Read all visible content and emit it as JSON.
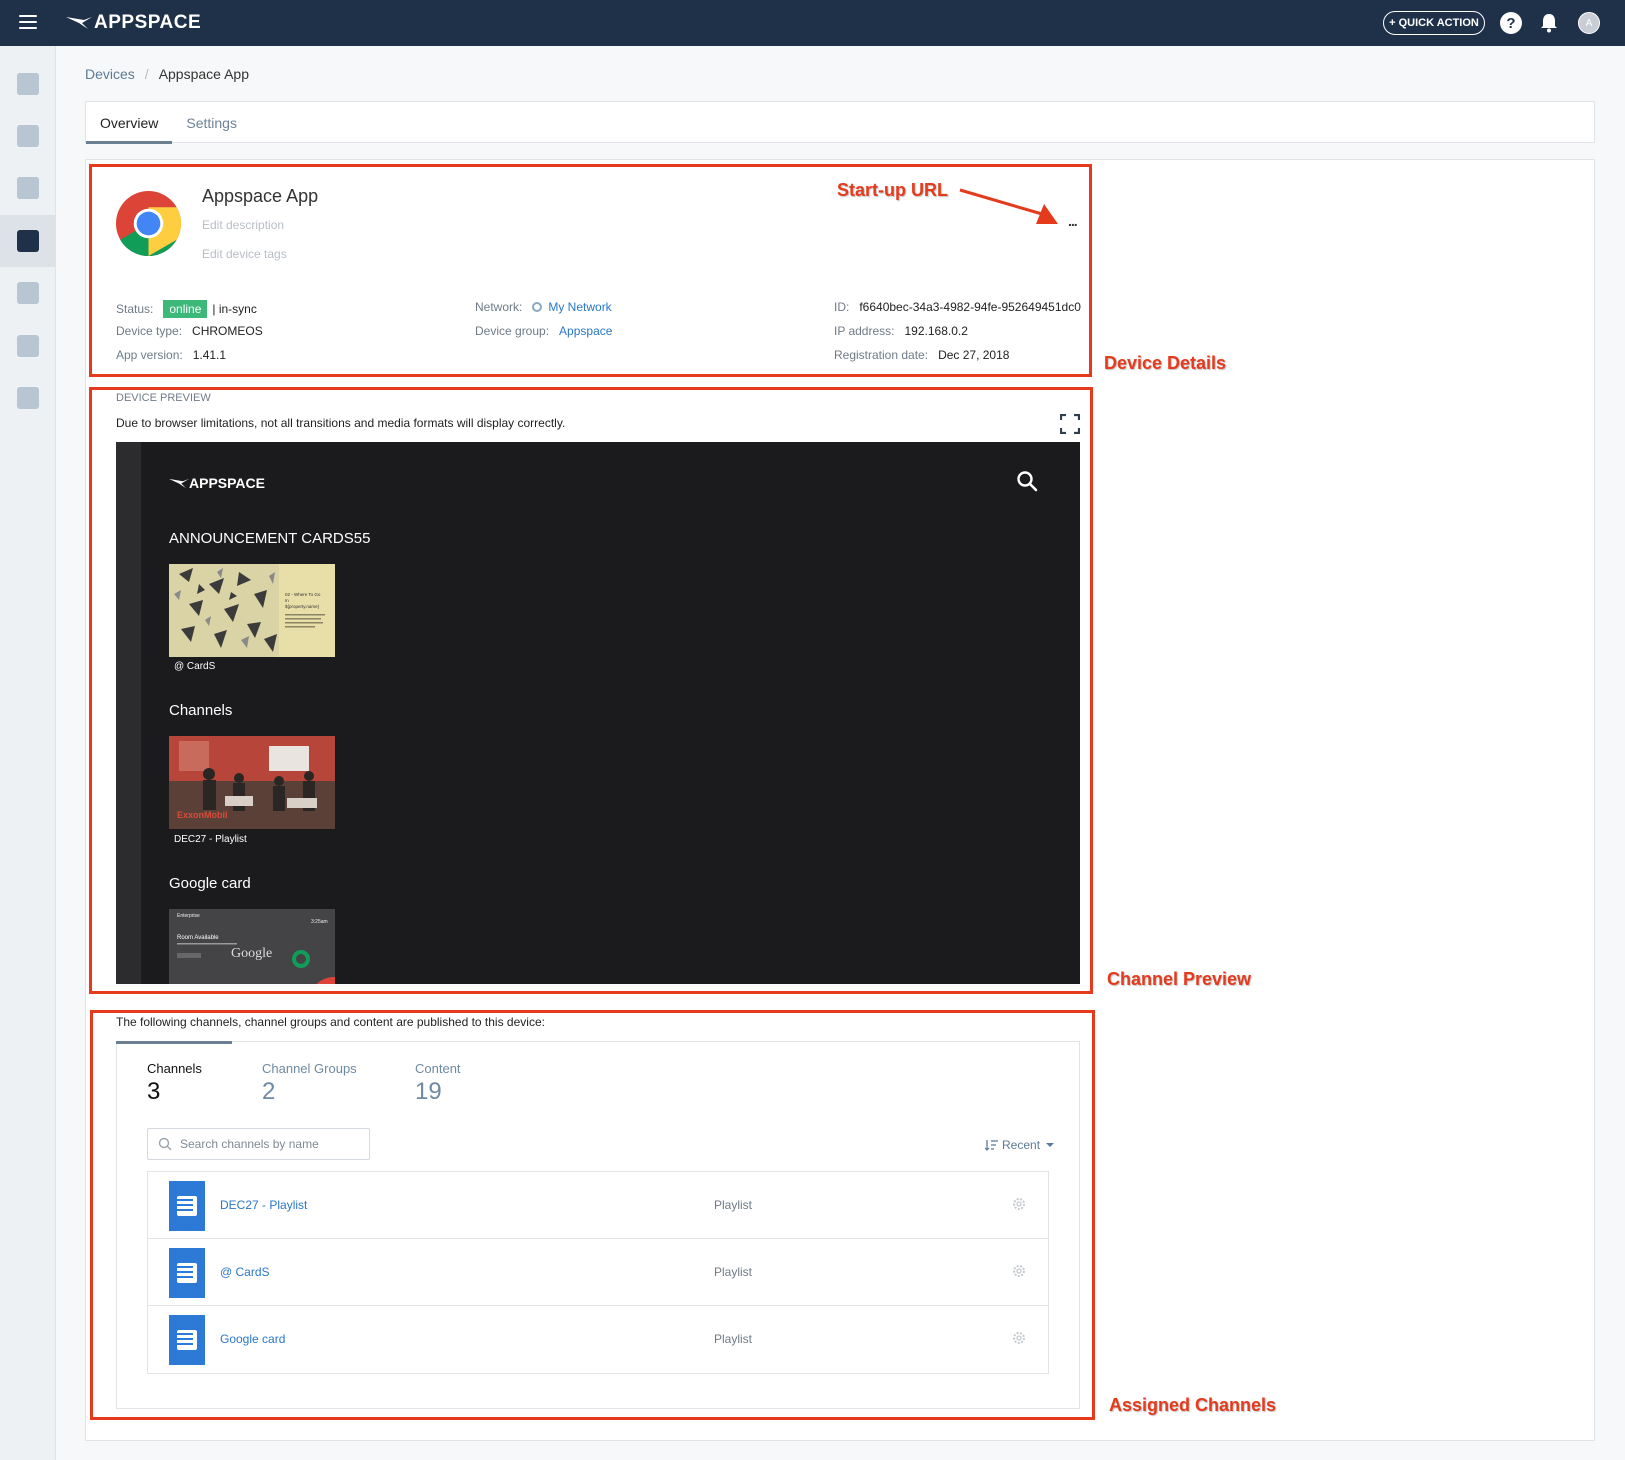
{
  "topbar": {
    "brand": "APPSPACE",
    "quick_action_label": "+ QUICK ACTION",
    "help_label": "?",
    "avatar_initial": "A"
  },
  "sidebar": {
    "items": [
      {
        "icon": "analytics-icon"
      },
      {
        "icon": "share-icon"
      },
      {
        "icon": "image-icon"
      },
      {
        "icon": "devices-icon",
        "active": true
      },
      {
        "icon": "users-icon"
      },
      {
        "icon": "tasks-icon"
      },
      {
        "icon": "flash-icon"
      }
    ]
  },
  "breadcrumb": {
    "parent": "Devices",
    "separator": "/",
    "current": "Appspace App"
  },
  "tabs": [
    {
      "label": "Overview",
      "active": true
    },
    {
      "label": "Settings",
      "active": false
    }
  ],
  "device": {
    "name": "Appspace App",
    "edit_description": "Edit description",
    "edit_tags": "Edit device tags",
    "more": "...",
    "status_label": "Status:",
    "status_badge": "online",
    "status_sync": "| in-sync",
    "device_type_label": "Device type:",
    "device_type": "CHROMEOS",
    "app_version_label": "App version:",
    "app_version": "1.41.1",
    "network_label": "Network:",
    "network": "My Network",
    "device_group_label": "Device group:",
    "device_group": "Appspace",
    "id_label": "ID:",
    "id": "f6640bec-34a3-4982-94fe-952649451dc0",
    "ip_label": "IP address:",
    "ip": "192.168.0.2",
    "registration_label": "Registration date:",
    "registration_date": "Dec 27, 2018"
  },
  "preview": {
    "title": "DEVICE PREVIEW",
    "note": "Due to browser limitations, not all transitions and media formats will display correctly.",
    "brand": "APPSPACE",
    "sections": [
      {
        "heading": "ANNOUNCEMENT CARDS55",
        "caption": "@ CardS"
      },
      {
        "heading": "Channels",
        "caption": "DEC27 - Playlist"
      },
      {
        "heading": "Google card",
        "caption": ""
      }
    ],
    "thumb_text": {
      "card_title": "02 - Where To Go",
      "card_sub": "In",
      "card_prop": "${property.name}",
      "exxon": "ExxonMobil",
      "google_enterprise": "Enterprise",
      "google_time": "3:25am",
      "google_room": "Room Available",
      "google_logo": "Google"
    }
  },
  "assigned": {
    "note": "The following channels, channel groups and content are published to this device:",
    "stats": [
      {
        "label": "Channels",
        "count": "3",
        "active": true
      },
      {
        "label": "Channel Groups",
        "count": "2",
        "active": false
      },
      {
        "label": "Content",
        "count": "19",
        "active": false
      }
    ],
    "search_placeholder": "Search channels by name",
    "sort_label": "Recent",
    "rows": [
      {
        "name": "DEC27 - Playlist",
        "type": "Playlist"
      },
      {
        "name": "@ CardS",
        "type": "Playlist"
      },
      {
        "name": "Google card",
        "type": "Playlist"
      }
    ]
  },
  "annotations": {
    "startup_url": "Start-up URL",
    "device_details": "Device Details",
    "channel_preview": "Channel Preview",
    "assigned_channels": "Assigned Channels",
    "color": "#e53a1c"
  }
}
